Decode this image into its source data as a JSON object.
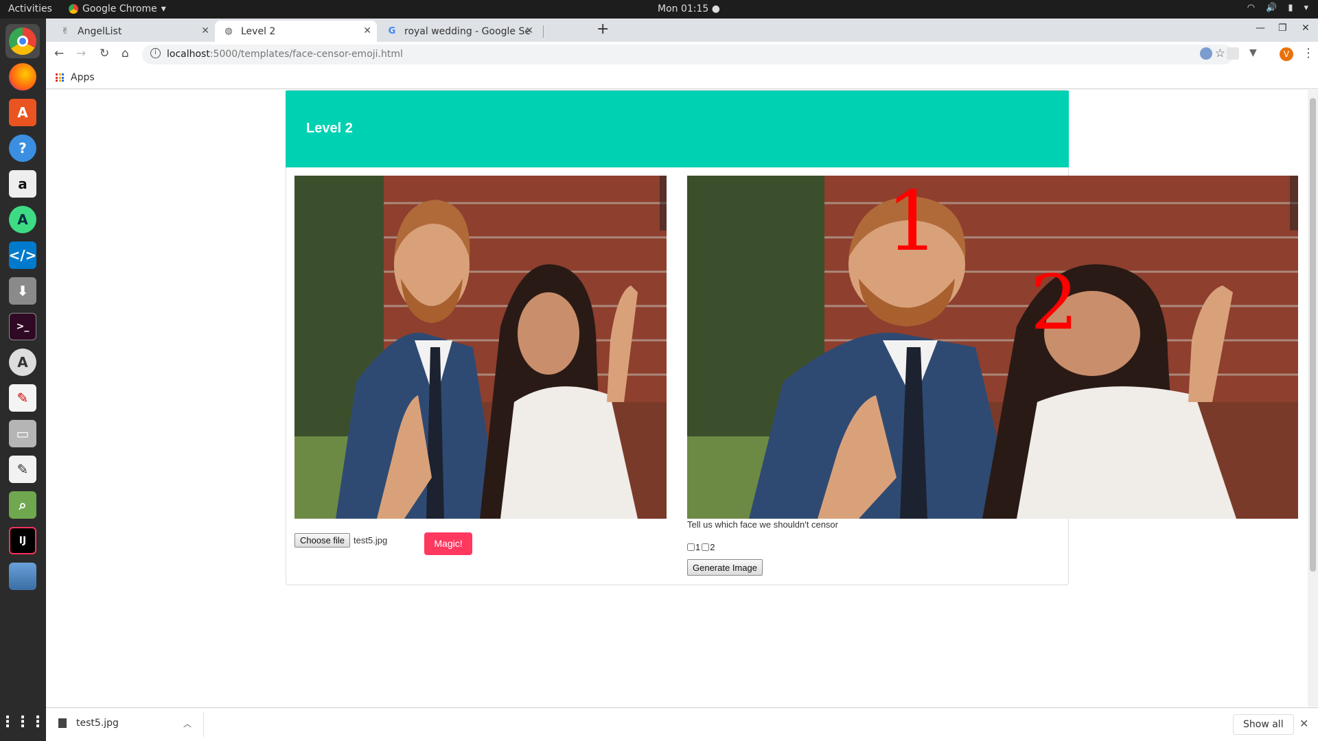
{
  "system_bar": {
    "activities": "Activities",
    "app_name": "Google Chrome",
    "clock": "Mon 01:15"
  },
  "dock": {
    "items": [
      "chrome",
      "firefox",
      "software-center",
      "help",
      "amazon",
      "android-studio",
      "vscode",
      "installer",
      "terminal",
      "updater",
      "document-viewer",
      "files",
      "text-editor",
      "image-viewer",
      "intellij",
      "drive",
      "show-apps"
    ]
  },
  "browser": {
    "tabs": [
      {
        "title": "AngelList"
      },
      {
        "title": "Level 2"
      },
      {
        "title": "royal wedding - Google Se"
      }
    ],
    "url_host": "localhost",
    "url_path": ":5000/templates/face-censor-emoji.html",
    "bookmarks": {
      "apps": "Apps"
    },
    "profile_initial": "V"
  },
  "page": {
    "title": "Level 2",
    "hero_color": "#00d1b2",
    "choose_file_label": "Choose file",
    "file_name": "test5.jpg",
    "magic_label": "Magic!",
    "magic_color": "#ff3860",
    "face_labels": [
      "1",
      "2"
    ],
    "face_label_color": "#ff0000",
    "tell_text": "Tell us which face we shouldn't censor",
    "checkbox_labels": [
      "1",
      "2"
    ],
    "generate_label": "Generate Image"
  },
  "downloads": {
    "file": "test5.jpg",
    "show_all": "Show all"
  }
}
